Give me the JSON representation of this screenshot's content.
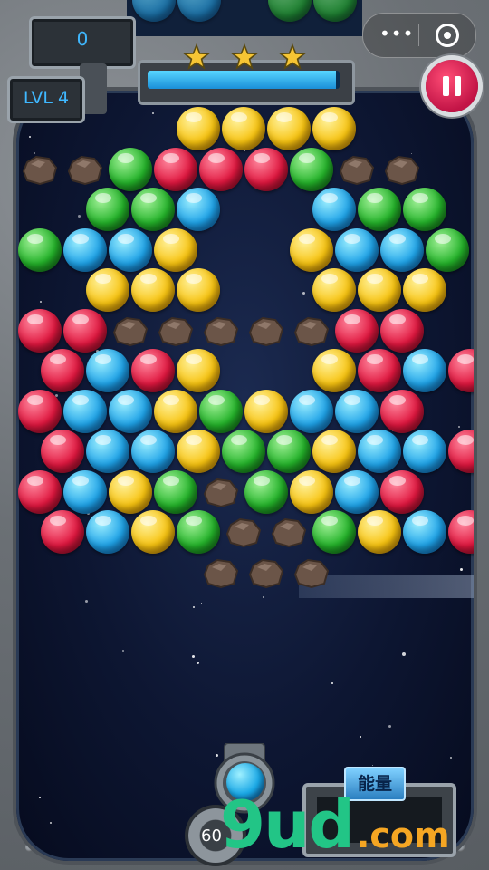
{
  "hud": {
    "score": "0",
    "level_label": "LVL 4",
    "progress_fraction": 0.98,
    "stars_earned": 3
  },
  "pause_button_icon": "pause-icon",
  "wechat_capsule": {
    "more_icon": "more-dots-icon",
    "close_icon": "target-circle-icon"
  },
  "shooter": {
    "ammo_count": "60",
    "loaded_bubble": "blue"
  },
  "energy_label": "能量",
  "watermark": {
    "main": "9ud",
    "suffix": ".com"
  },
  "colors": {
    "red": "#e0173f",
    "blue": "#1fa3e8",
    "yellow": "#f7c310",
    "green": "#24b32a",
    "accent_hud": "#3fb8ff",
    "pause": "#d6194a"
  },
  "board": [
    {
      "row": 0,
      "cells": [
        "yellow",
        "yellow",
        "yellow",
        "yellow"
      ],
      "start": 3
    },
    {
      "row": 1,
      "cells": [
        "rock",
        "rock",
        "green",
        "red",
        "red",
        "red",
        "green",
        "rock",
        "rock"
      ],
      "start": 0
    },
    {
      "row": 2,
      "cells": [
        "green",
        "green",
        "blue",
        null,
        null,
        "blue",
        "green",
        "green"
      ],
      "start": 1
    },
    {
      "row": 3,
      "cells": [
        "green",
        "blue",
        "blue",
        "yellow",
        null,
        null,
        "yellow",
        "blue",
        "blue",
        "green"
      ],
      "start": 0
    },
    {
      "row": 4,
      "cells": [
        "yellow",
        "yellow",
        "yellow",
        null,
        null,
        "yellow",
        "yellow",
        "yellow"
      ],
      "start": 1
    },
    {
      "row": 5,
      "cells": [
        "red",
        "red",
        "rock",
        "rock",
        "rock",
        "rock",
        "rock",
        "red",
        "red"
      ],
      "start": 0
    },
    {
      "row": 6,
      "cells": [
        "red",
        "blue",
        "red",
        "yellow",
        null,
        null,
        "yellow",
        "red",
        "blue",
        "red"
      ],
      "start": 0
    },
    {
      "row": 7,
      "cells": [
        "red",
        "blue",
        "blue",
        "yellow",
        "green",
        "yellow",
        "blue",
        "blue",
        "red"
      ],
      "start": 0
    },
    {
      "row": 8,
      "cells": [
        "red",
        "blue",
        "blue",
        "yellow",
        "green",
        "green",
        "yellow",
        "blue",
        "blue",
        "red"
      ],
      "start": 0
    },
    {
      "row": 9,
      "cells": [
        "red",
        "blue",
        "yellow",
        "green",
        "rock",
        "green",
        "yellow",
        "blue",
        "red"
      ],
      "start": 0
    },
    {
      "row": 10,
      "cells": [
        "red",
        "blue",
        "yellow",
        "green",
        "rock",
        "rock",
        "green",
        "yellow",
        "blue",
        "red"
      ],
      "start": 0
    },
    {
      "row": 11,
      "cells": [
        "rock",
        "rock",
        "rock"
      ],
      "start": 4
    }
  ]
}
